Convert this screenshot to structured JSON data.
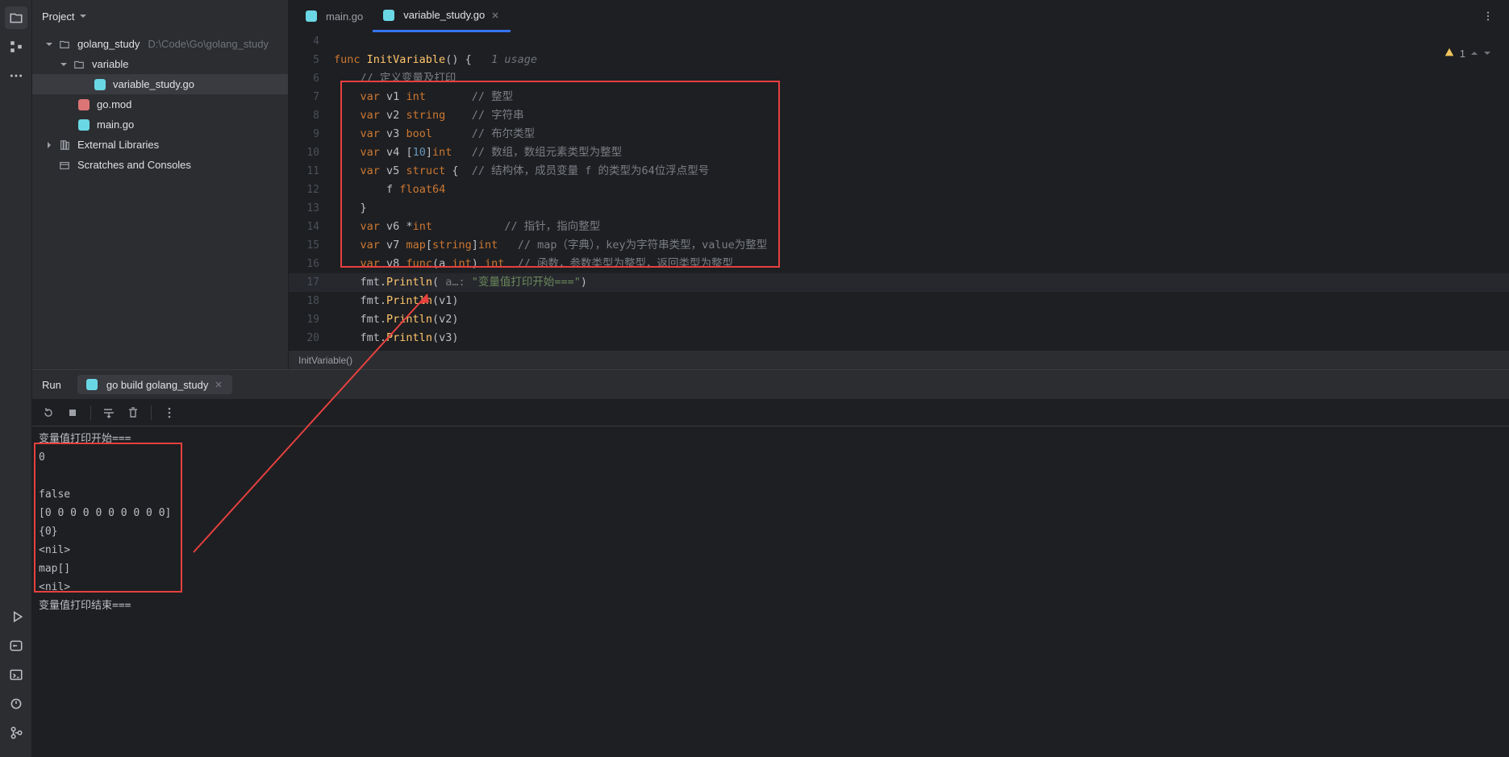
{
  "sidebar": {
    "title": "Project",
    "tree": {
      "root": {
        "name": "golang_study",
        "path": "D:\\Code\\Go\\golang_study"
      },
      "folder1": "variable",
      "file1": "variable_study.go",
      "file2": "go.mod",
      "file3": "main.go",
      "ext_libs": "External Libraries",
      "scratches": "Scratches and Consoles"
    }
  },
  "tabs": {
    "tab1": "main.go",
    "tab2": "variable_study.go"
  },
  "inspection": {
    "count": "1"
  },
  "code": {
    "line4": "",
    "l5": {
      "kw": "func",
      "name": "InitVariable",
      "rest": "() {",
      "usage": "1 usage"
    },
    "l6_comment": "// 定义变量及打印",
    "l7": {
      "kw": "var",
      "id": "v1",
      "type": "int",
      "comment": "// 整型"
    },
    "l8": {
      "kw": "var",
      "id": "v2",
      "type": "string",
      "comment": "// 字符串"
    },
    "l9": {
      "kw": "var",
      "id": "v3",
      "type": "bool",
      "comment": "// 布尔类型"
    },
    "l10": {
      "kw": "var",
      "id": "v4",
      "arr": "[10]",
      "type": "int",
      "comment": "// 数组，数组元素类型为整型"
    },
    "l11": {
      "kw": "var",
      "id": "v5",
      "type": "struct",
      "brace": " {",
      "comment": "// 结构体，成员变量 f 的类型为64位浮点型号"
    },
    "l12": {
      "id": "f",
      "type": "float64"
    },
    "l13": "}",
    "l14": {
      "kw": "var",
      "id": "v6",
      "star": "*",
      "type": "int",
      "comment": "// 指针，指向整型"
    },
    "l15": {
      "kw": "var",
      "id": "v7",
      "type": "map[string]int",
      "comment": "// map（字典），key为字符串类型，value为整型"
    },
    "l16": {
      "kw": "var",
      "id": "v8",
      "type": "func(a int) int",
      "comment": "// 函数，参数类型为整型，返回类型为整型"
    },
    "l17": {
      "fmt": "fmt",
      "dot": ".",
      "fn": "Println",
      "hint": "a…:",
      "str": "\"变量值打印开始===\""
    },
    "l18": {
      "fmt": "fmt",
      "dot": ".",
      "fn": "Println",
      "arg": "v1"
    },
    "l19": {
      "fmt": "fmt",
      "dot": ".",
      "fn": "Println",
      "arg": "v2"
    },
    "l20": {
      "fmt": "fmt",
      "dot": ".",
      "fn": "Println",
      "arg": "v3"
    }
  },
  "breadcrumb": "InitVariable()",
  "run": {
    "label": "Run",
    "tab": "go build golang_study",
    "output": [
      "变量值打印开始===",
      "0",
      "",
      "false",
      "[0 0 0 0 0 0 0 0 0 0]",
      "{0}",
      "<nil>",
      "map[]",
      "<nil>",
      "变量值打印结束==="
    ]
  },
  "gutter": {
    "start": 4,
    "end": 20
  }
}
